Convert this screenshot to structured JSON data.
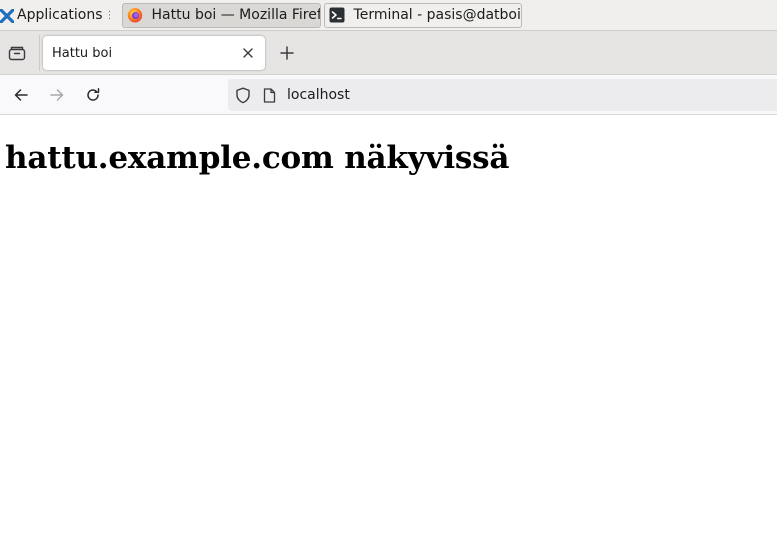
{
  "taskbar": {
    "apps_label": "Applications",
    "tasks": [
      {
        "label": "Hattu boi — Mozilla Firefox",
        "icon": "firefox-icon",
        "active": true
      },
      {
        "label": "Terminal - pasis@datboi-vi...",
        "icon": "terminal-icon",
        "active": false
      }
    ]
  },
  "browser": {
    "tab": {
      "title": "Hattu boi"
    },
    "url": "localhost"
  },
  "page": {
    "heading": "hattu.example.com näkyvissä"
  },
  "colors": {
    "taskbar_bg": "#f0efee",
    "tabstrip_bg": "#e6e5e3",
    "urlbar_bg": "#ececef",
    "xfce_blue": "#2a84d6"
  }
}
